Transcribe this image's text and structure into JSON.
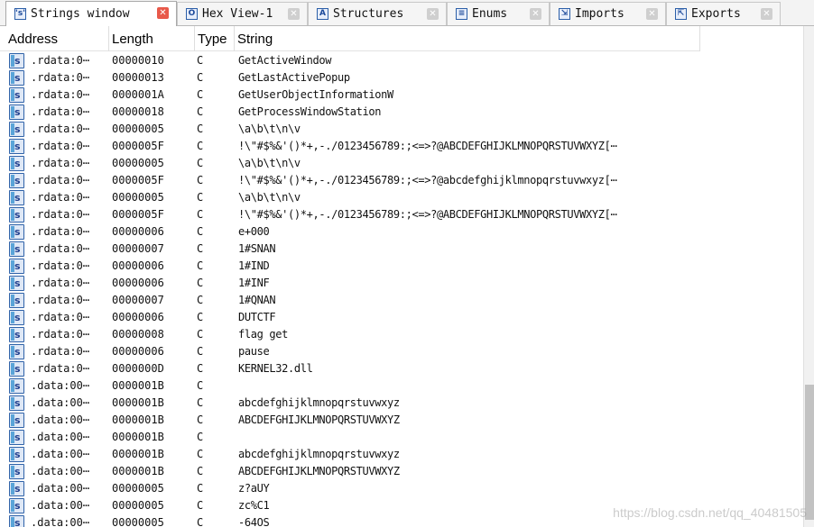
{
  "tabs": [
    {
      "label": "Strings window",
      "icon": "strings-icon",
      "active": true
    },
    {
      "label": "Hex View-1",
      "icon": "hex-view-icon",
      "active": false
    },
    {
      "label": "Structures",
      "icon": "structures-icon",
      "active": false
    },
    {
      "label": "Enums",
      "icon": "enums-icon",
      "active": false
    },
    {
      "label": "Imports",
      "icon": "imports-icon",
      "active": false
    },
    {
      "label": "Exports",
      "icon": "exports-icon",
      "active": false
    }
  ],
  "columns": {
    "address": "Address",
    "length": "Length",
    "type": "Type",
    "string": "String"
  },
  "rows": [
    {
      "address": ".rdata:0⋯",
      "length": "00000010",
      "type": "C",
      "string": "GetActiveWindow"
    },
    {
      "address": ".rdata:0⋯",
      "length": "00000013",
      "type": "C",
      "string": "GetLastActivePopup"
    },
    {
      "address": ".rdata:0⋯",
      "length": "0000001A",
      "type": "C",
      "string": "GetUserObjectInformationW"
    },
    {
      "address": ".rdata:0⋯",
      "length": "00000018",
      "type": "C",
      "string": "GetProcessWindowStation"
    },
    {
      "address": ".rdata:0⋯",
      "length": "00000005",
      "type": "C",
      "string": "\\a\\b\\t\\n\\v"
    },
    {
      "address": ".rdata:0⋯",
      "length": "0000005F",
      "type": "C",
      "string": " !\\\"#$%&'()*+,-./0123456789:;<=>?@ABCDEFGHIJKLMNOPQRSTUVWXYZ[⋯"
    },
    {
      "address": ".rdata:0⋯",
      "length": "00000005",
      "type": "C",
      "string": "\\a\\b\\t\\n\\v"
    },
    {
      "address": ".rdata:0⋯",
      "length": "0000005F",
      "type": "C",
      "string": " !\\\"#$%&'()*+,-./0123456789:;<=>?@abcdefghijklmnopqrstuvwxyz[⋯"
    },
    {
      "address": ".rdata:0⋯",
      "length": "00000005",
      "type": "C",
      "string": "\\a\\b\\t\\n\\v"
    },
    {
      "address": ".rdata:0⋯",
      "length": "0000005F",
      "type": "C",
      "string": " !\\\"#$%&'()*+,-./0123456789:;<=>?@ABCDEFGHIJKLMNOPQRSTUVWXYZ[⋯"
    },
    {
      "address": ".rdata:0⋯",
      "length": "00000006",
      "type": "C",
      "string": "e+000"
    },
    {
      "address": ".rdata:0⋯",
      "length": "00000007",
      "type": "C",
      "string": "1#SNAN"
    },
    {
      "address": ".rdata:0⋯",
      "length": "00000006",
      "type": "C",
      "string": "1#IND"
    },
    {
      "address": ".rdata:0⋯",
      "length": "00000006",
      "type": "C",
      "string": "1#INF"
    },
    {
      "address": ".rdata:0⋯",
      "length": "00000007",
      "type": "C",
      "string": "1#QNAN"
    },
    {
      "address": ".rdata:0⋯",
      "length": "00000006",
      "type": "C",
      "string": "DUTCTF"
    },
    {
      "address": ".rdata:0⋯",
      "length": "00000008",
      "type": "C",
      "string": "flag get"
    },
    {
      "address": ".rdata:0⋯",
      "length": "00000006",
      "type": "C",
      "string": "pause"
    },
    {
      "address": ".rdata:0⋯",
      "length": "0000000D",
      "type": "C",
      "string": "KERNEL32.dll"
    },
    {
      "address": ".data:00⋯",
      "length": "0000001B",
      "type": "C",
      "string": ""
    },
    {
      "address": ".data:00⋯",
      "length": "0000001B",
      "type": "C",
      "string": "abcdefghijklmnopqrstuvwxyz"
    },
    {
      "address": ".data:00⋯",
      "length": "0000001B",
      "type": "C",
      "string": "ABCDEFGHIJKLMNOPQRSTUVWXYZ"
    },
    {
      "address": ".data:00⋯",
      "length": "0000001B",
      "type": "C",
      "string": ""
    },
    {
      "address": ".data:00⋯",
      "length": "0000001B",
      "type": "C",
      "string": "abcdefghijklmnopqrstuvwxyz"
    },
    {
      "address": ".data:00⋯",
      "length": "0000001B",
      "type": "C",
      "string": "ABCDEFGHIJKLMNOPQRSTUVWXYZ"
    },
    {
      "address": ".data:00⋯",
      "length": "00000005",
      "type": "C",
      "string": "z?aUY"
    },
    {
      "address": ".data:00⋯",
      "length": "00000005",
      "type": "C",
      "string": "zc%C1"
    },
    {
      "address": ".data:00⋯",
      "length": "00000005",
      "type": "C",
      "string": "-64OS"
    }
  ],
  "watermark": "https://blog.csdn.net/qq_40481505",
  "colors": {
    "accent": "#2f62a8",
    "close_active": "#e8594a"
  }
}
